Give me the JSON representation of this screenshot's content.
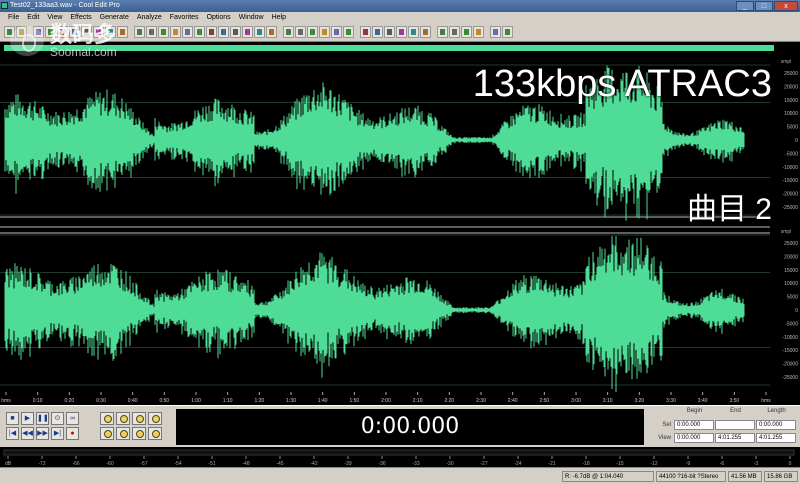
{
  "window": {
    "title": "Test02_133aa3.wav - Cool Edit Pro",
    "controls": [
      "_",
      "□",
      "x"
    ]
  },
  "menu": [
    "File",
    "Edit",
    "View",
    "Effects",
    "Generate",
    "Analyze",
    "Favorites",
    "Options",
    "Window",
    "Help"
  ],
  "watermark": {
    "brand": "数码多",
    "site": "Soomal.com"
  },
  "overlay": {
    "title": "133kbps ATRAC3",
    "track": "曲目 2"
  },
  "amplitude_axis": {
    "labels": [
      "smpl",
      "25000",
      "20000",
      "15000",
      "10000",
      "5000",
      "0",
      "-5000",
      "-10000",
      "-15000",
      "-20000",
      "-25000"
    ],
    "bottom_label": "smpl"
  },
  "time_ruler": {
    "labels": [
      "hms",
      "0:10",
      "0:20",
      "0:30",
      "0:40",
      "0:50",
      "1:00",
      "1:10",
      "1:20",
      "1:30",
      "1:40",
      "1:50",
      "2:00",
      "2:10",
      "2:20",
      "2:30",
      "2:40",
      "2:50",
      "3:00",
      "3:10",
      "3:20",
      "3:30",
      "3:40",
      "3:50",
      "hms"
    ]
  },
  "transport": {
    "buttons": [
      "■",
      "▶",
      "❚❚",
      "⊙",
      "∞",
      "|◀",
      "◀◀",
      "▶▶",
      "▶|",
      "●"
    ]
  },
  "time_display": "0:00.000",
  "selection": {
    "headers": [
      "Begin",
      "End",
      "Length"
    ],
    "sel_label": "Sel",
    "view_label": "View",
    "sel": [
      "0:00.000",
      "",
      "0:00.000"
    ],
    "view": [
      "0:00.000",
      "4:01.255",
      "4:01.255"
    ]
  },
  "level_ruler": {
    "labels": [
      "dB",
      "-72",
      "-66",
      "-60",
      "-57",
      "-54",
      "-51",
      "-48",
      "-45",
      "-42",
      "-39",
      "-36",
      "-33",
      "-30",
      "-27",
      "-24",
      "-21",
      "-18",
      "-15",
      "-12",
      "-9",
      "-6",
      "-3",
      "0"
    ]
  },
  "status": {
    "cursor": "R: -6.7dB @  1:04.040",
    "format": "44100 ?16-bit ?Stereo",
    "size": "41.56 MB",
    "free": "15.86 GB free"
  },
  "colors": {
    "waveform": "#4fdc96",
    "background": "#000000",
    "chrome": "#d4d0c8"
  }
}
